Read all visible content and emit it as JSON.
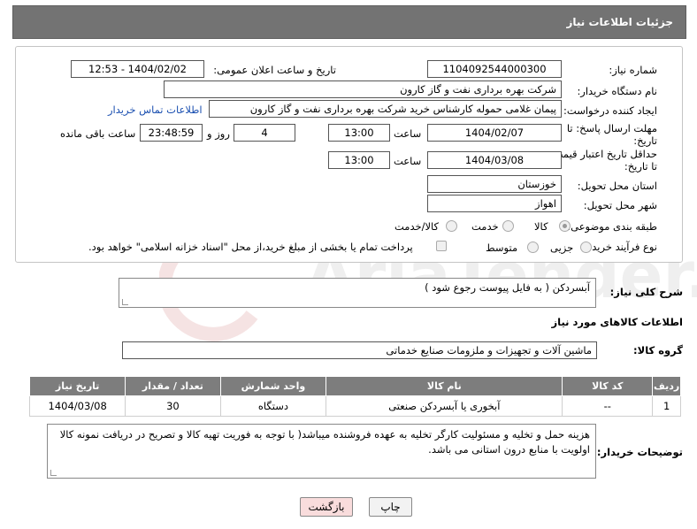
{
  "header": {
    "title": "جزئیات اطلاعات نیاز"
  },
  "form": {
    "need_number_label": "شماره نیاز:",
    "need_number": "1104092544000300",
    "announce_label": "تاریخ و ساعت اعلان عمومی:",
    "announce_value": "1404/02/02 - 12:53",
    "buyer_org_label": "نام دستگاه خریدار:",
    "buyer_org": "شرکت بهره برداری نفت و گاز کارون",
    "creator_label": "ایجاد کننده درخواست:",
    "creator": "پیمان غلامی حموله کارشناس خرید شرکت بهره برداری نفت و گاز کارون",
    "contact_link": "اطلاعات تماس خریدار",
    "deadline_label_1": "مهلت ارسال پاسخ: تا",
    "deadline_label_2": "تاریخ:",
    "deadline_date": "1404/02/07",
    "time_label": "ساعت",
    "deadline_time": "13:00",
    "days_value": "4",
    "days_label": "روز و",
    "remaining_time": "23:48:59",
    "remaining_label": "ساعت باقی مانده",
    "validity_label_1": "حداقل تاریخ اعتبار قیمت:",
    "validity_label_2": "تا تاریخ:",
    "validity_date": "1404/03/08",
    "validity_time": "13:00",
    "province_label": "استان محل تحویل:",
    "province": "خوزستان",
    "city_label": "شهر محل تحویل:",
    "city": "اهواز",
    "category_label": "طبقه بندی موضوعی:",
    "category_options": [
      "کالا",
      "خدمت",
      "کالا/خدمت"
    ],
    "process_label": "نوع فرآیند خرید :",
    "process_options": [
      "جزیی",
      "متوسط"
    ],
    "payment_note": "پرداخت تمام یا بخشی از مبلغ خرید،از محل \"اسناد خزانه اسلامی\" خواهد بود."
  },
  "description": {
    "label": "شرح کلی نیاز:",
    "text": "آبسردکن ( به فایل پیوست رجوع شود )"
  },
  "goods": {
    "section_title": "اطلاعات کالاهای مورد نیاز",
    "group_label": "گروه کالا:",
    "group_value": "ماشین آلات و تجهیزات و ملزومات صنایع خدماتی",
    "columns": [
      "ردیف",
      "کد کالا",
      "نام کالا",
      "واحد شمارش",
      "تعداد / مقدار",
      "تاریخ نیاز"
    ],
    "rows": [
      [
        "1",
        "--",
        "آبخوری یا آبسردکن صنعتی",
        "دستگاه",
        "30",
        "1404/03/08"
      ]
    ]
  },
  "buyer_notes": {
    "label": "توضیحات خریدار:",
    "text": "هزینه حمل و تخلیه و مسئولیت کارگر تخلیه به عهده فروشنده میباشد( با توجه به فوریت تهیه کالا و تصریح در دریافت نمونه کالا اولویت با منابع درون استانی می باشد."
  },
  "buttons": {
    "print": "چاپ",
    "back": "بازگشت"
  },
  "watermark": {
    "text": "AriaTender.net"
  },
  "colors": {
    "header_bg": "#737373",
    "table_header_bg": "#7d7d7d",
    "link": "#1a4fb0",
    "back_button_bg": "#f9dcdc"
  }
}
